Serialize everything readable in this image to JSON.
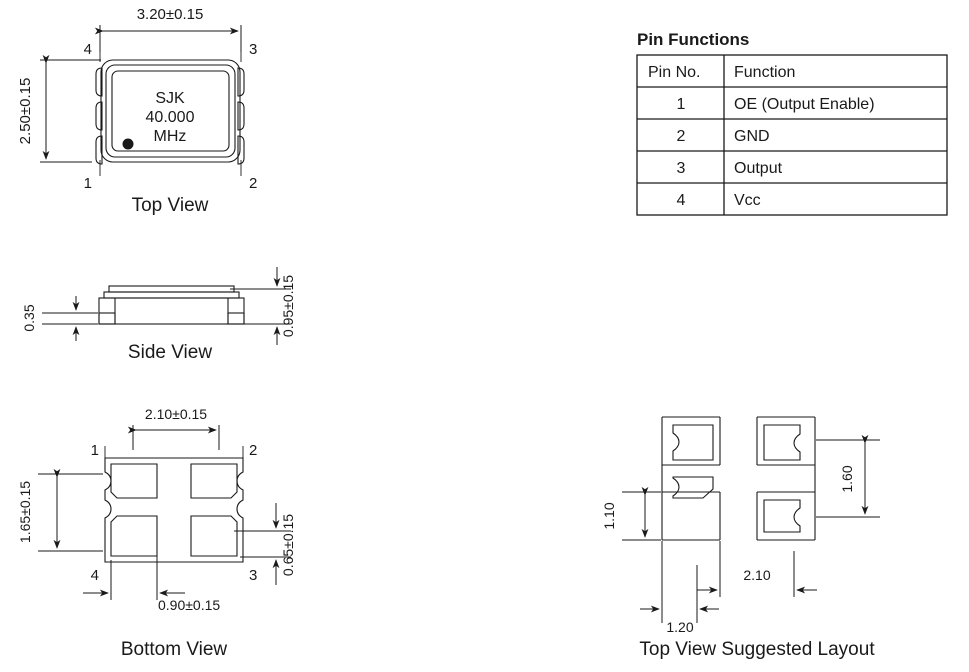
{
  "document": {
    "type": "mechanical-package-drawing",
    "component": "SMD crystal oscillator 3.2 x 2.5 mm"
  },
  "top_view": {
    "title": "Top View",
    "marking": {
      "line1": "SJK",
      "line2": "40.000",
      "line3": "MHz"
    },
    "dim_width": "3.20±0.15",
    "dim_height": "2.50±0.15",
    "pins": {
      "p1": "1",
      "p2": "2",
      "p3": "3",
      "p4": "4"
    }
  },
  "side_view": {
    "title": "Side View",
    "dim_pad_height": "0.35",
    "dim_total_height": "0.95±0.15"
  },
  "bottom_view": {
    "title": "Bottom View",
    "dim_pad_pitch_x": "2.10±0.15",
    "dim_pad_pitch_y": "1.65±0.15",
    "dim_pad_width": "0.90±0.15",
    "dim_pad_height": "0.65±0.15",
    "pins": {
      "p1": "1",
      "p2": "2",
      "p3": "3",
      "p4": "4"
    }
  },
  "suggested_layout": {
    "title": "Top View Suggested Layout",
    "dim_pad_height": "1.10",
    "dim_pitch_y": "1.60",
    "dim_pitch_x": "2.10",
    "dim_pad_width": "1.20"
  },
  "pin_table": {
    "title": "Pin Functions",
    "columns": [
      "Pin No.",
      "Function"
    ],
    "rows": [
      {
        "pin": "1",
        "function": "OE (Output Enable)"
      },
      {
        "pin": "2",
        "function": "GND"
      },
      {
        "pin": "3",
        "function": "Output"
      },
      {
        "pin": "4",
        "function": "Vcc"
      }
    ]
  }
}
